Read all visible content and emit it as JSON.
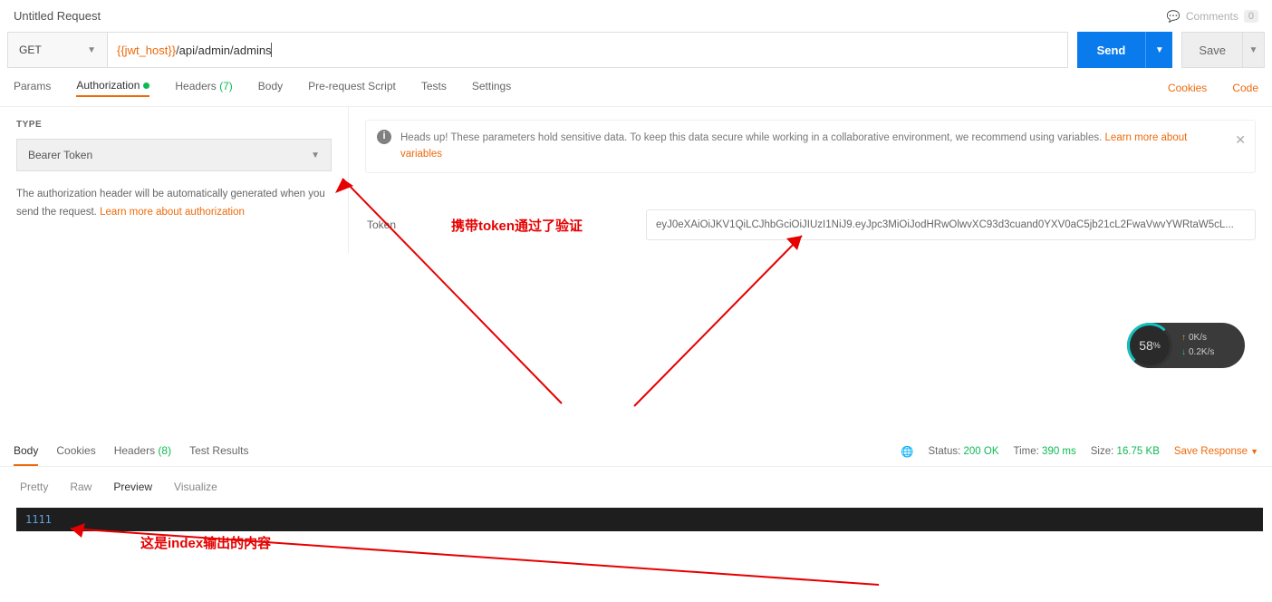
{
  "title": "Untitled Request",
  "comments": {
    "label": "Comments",
    "count": "0"
  },
  "request": {
    "method": "GET",
    "url_var": "{{jwt_host}}",
    "url_path": "/api/admin/admins"
  },
  "buttons": {
    "send": "Send",
    "save": "Save"
  },
  "req_tabs": {
    "params": "Params",
    "authorization": "Authorization",
    "headers": "Headers",
    "headers_count": "(7)",
    "body": "Body",
    "prerequest": "Pre-request Script",
    "tests": "Tests",
    "settings": "Settings",
    "cookies": "Cookies",
    "code": "Code"
  },
  "auth": {
    "type_label": "TYPE",
    "type_value": "Bearer Token",
    "desc1": "The authorization header will be automatically generated when you send the request. ",
    "desc_link": "Learn more about authorization",
    "banner": "Heads up! These parameters hold sensitive data. To keep this data secure while working in a collaborative environment, we recommend using variables. ",
    "banner_link": "Learn more about variables",
    "token_label": "Token",
    "token_value": "eyJ0eXAiOiJKV1QiLCJhbGciOiJIUzI1NiJ9.eyJpc3MiOiJodHRwOlwvXC93d3cuand0YXV0aC5jb21cL2FwaVwvYWRtaW5cL..."
  },
  "annotations": {
    "a1": "携带token通过了验证",
    "a2": "这是index输出的内容"
  },
  "resp_tabs": {
    "body": "Body",
    "cookies": "Cookies",
    "headers": "Headers",
    "headers_count": "(8)",
    "tests": "Test Results"
  },
  "resp_meta": {
    "status_label": "Status:",
    "status_value": "200 OK",
    "time_label": "Time:",
    "time_value": "390 ms",
    "size_label": "Size:",
    "size_value": "16.75 KB",
    "save_response": "Save Response"
  },
  "view_tabs": {
    "pretty": "Pretty",
    "raw": "Raw",
    "preview": "Preview",
    "visualize": "Visualize"
  },
  "body_text": "1111",
  "net_widget": {
    "percent": "58",
    "up": "0K/s",
    "down": "0.2K/s"
  }
}
